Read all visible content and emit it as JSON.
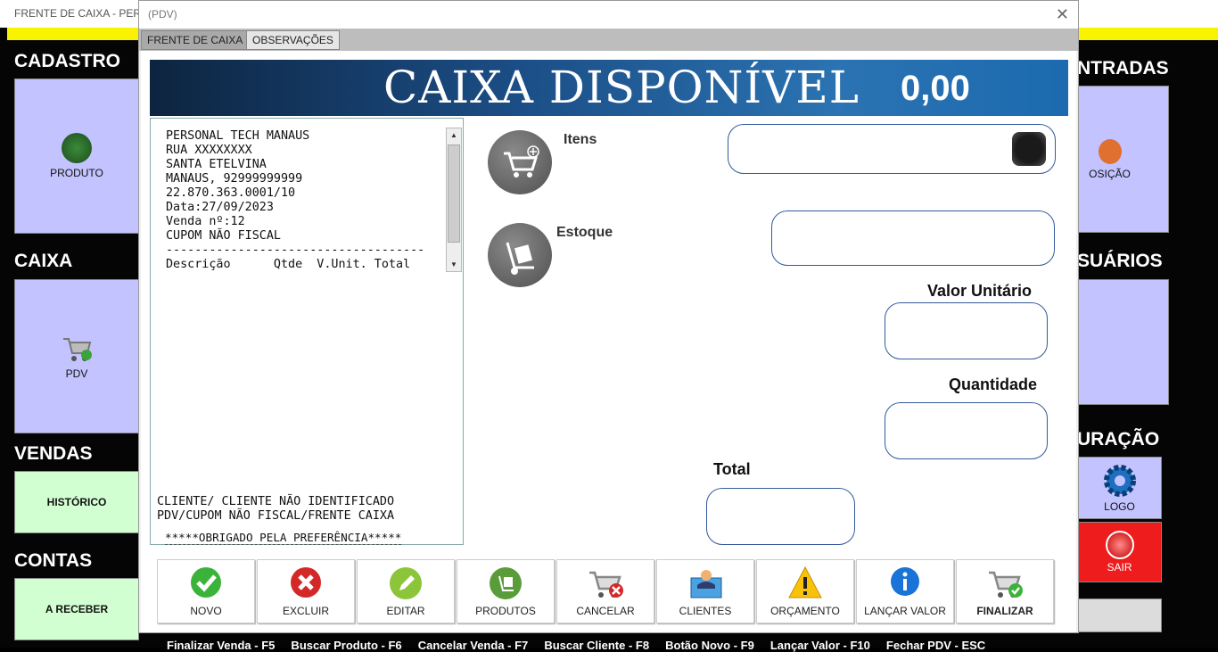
{
  "background_app": {
    "title": "FRENTE DE CAIXA - PERSO",
    "sections": {
      "cadastro": "CADASTRO",
      "caixa": "CAIXA",
      "vendas": "VENDAS",
      "contas": "CONTAS",
      "entradas": "NTRADAS",
      "usuarios": "SUÁRIOS",
      "configuracao": "URAÇÃO"
    },
    "tiles": {
      "produto": "PRODUTO",
      "pdv": "PDV",
      "historico": "HISTÓRICO",
      "a_receber": "A RECEBER",
      "posicao": "OSIÇÃO",
      "logo": "LOGO",
      "sair": "SAIR"
    },
    "shortcuts": "Finalizar Venda - F5     Buscar Produto - F6     Cancelar Venda - F7     Buscar Cliente - F8     Botão Novo - F9     Lançar Valor - F10     Fechar PDV - ESC"
  },
  "dialog": {
    "title": "(PDV)",
    "tabs": [
      "FRENTE DE CAIXA",
      "OBSERVAÇÕES"
    ],
    "banner": {
      "title": "CAIXA DISPONÍVEL",
      "value": "0,00"
    },
    "receipt": {
      "lines": "PERSONAL TECH MANAUS\nRUA XXXXXXXX\nSANTA ETELVINA\nMANAUS, 92999999999\n22.870.363.0001/10\nData:27/09/2023\nVenda nº:12\nCUPOM NÃO FISCAL\n------------------------------------\nDescrição      Qtde  V.Unit. Total",
      "footer": "CLIENTE/ CLIENTE NÃO IDENTIFICADO\nPDV/CUPOM NÃO FISCAL/FRENTE CAIXA",
      "thanks": "*****OBRIGADO PELA PREFERÊNCIA*****"
    },
    "labels": {
      "itens": "Itens",
      "estoque": "Estoque",
      "valor_unitario": "Valor Unitário",
      "quantidade": "Quantidade",
      "total": "Total"
    },
    "buttons": [
      "NOVO",
      "EXCLUIR",
      "EDITAR",
      "PRODUTOS",
      "CANCELAR",
      "CLIENTES",
      "ORÇAMENTO",
      "LANÇAR VALOR",
      "FINALIZAR"
    ]
  }
}
